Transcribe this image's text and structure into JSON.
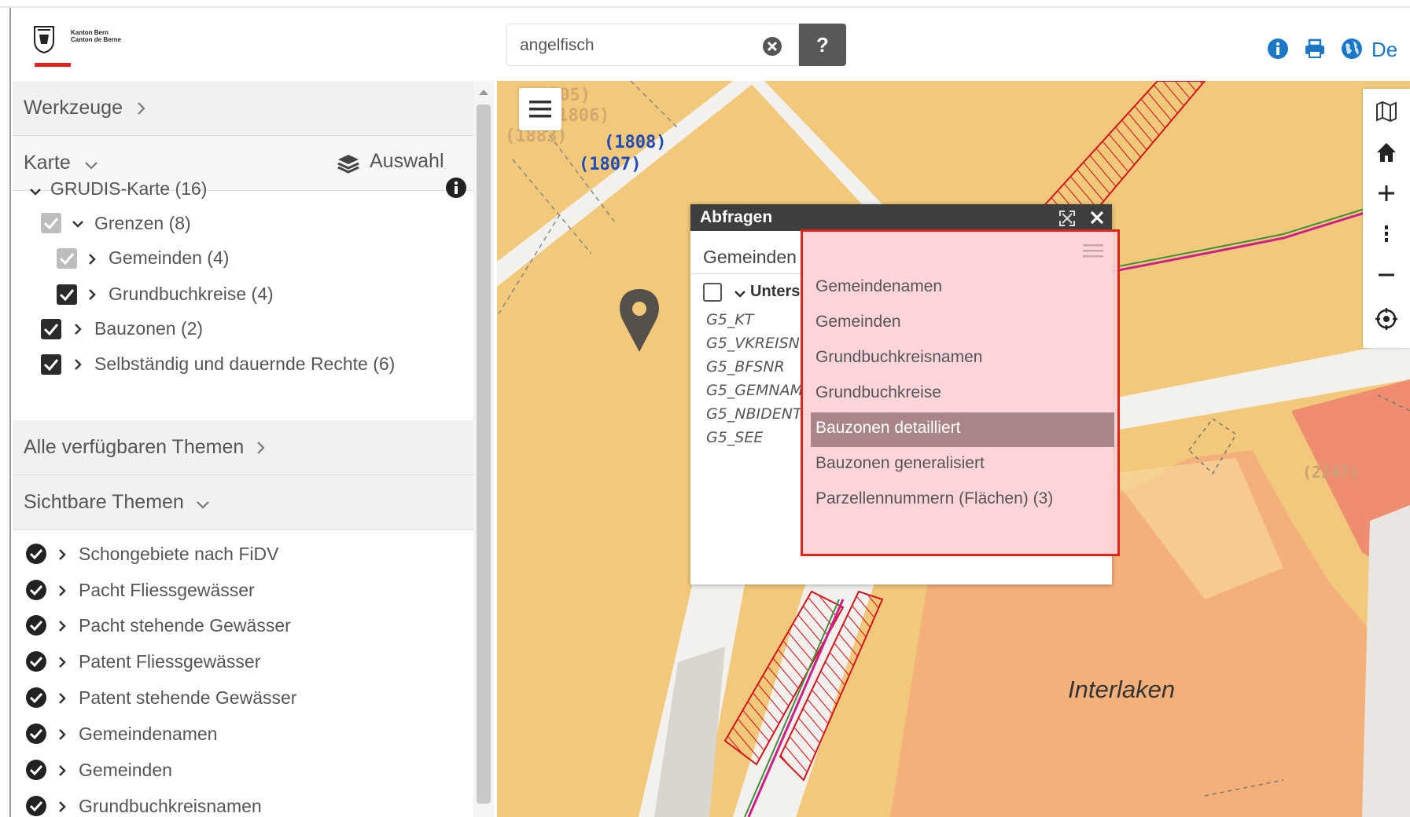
{
  "header": {
    "logo_line1": "Kanton Bern",
    "logo_line2": "Canton de Berne",
    "search_value": "angelfisch",
    "help_label": "?",
    "language": "De",
    "icons": [
      "info-icon",
      "print-icon",
      "globe-icon"
    ]
  },
  "sidebar": {
    "werkzeuge": "Werkzeuge",
    "karte": "Karte",
    "auswahl": "Auswahl",
    "tree": [
      {
        "label": "GRUDIS-Karte (16)"
      },
      {
        "label": "Grenzen (8)"
      },
      {
        "label": "Gemeinden (4)"
      },
      {
        "label": "Grundbuchkreise (4)"
      },
      {
        "label": "Bauzonen (2)"
      },
      {
        "label": "Selbständig und dauernde Rechte (6)"
      }
    ],
    "alle_themen": "Alle verfügbaren Themen",
    "sichtbare_themen": "Sichtbare Themen",
    "visible_themes": [
      "Schongebiete nach FiDV",
      "Pacht Fliessgewässer",
      "Pacht stehende Gewässer",
      "Patent Fliessgewässer",
      "Patent stehende Gewässer",
      "Gemeindenamen",
      "Gemeinden",
      "Grundbuchkreisnamen"
    ]
  },
  "map": {
    "labels": [
      "805)",
      "(1806)",
      "(1883)",
      "(1808)",
      "(1807)",
      "(2247)"
    ],
    "city": "Interlaken"
  },
  "popup": {
    "title": "Abfragen",
    "subtitle": "Gemeinden",
    "row_label": "Unters",
    "attributes": [
      "G5_KT",
      "G5_VKREISN",
      "G5_BFSNR",
      "G5_GEMNAM",
      "G5_NBIDENT",
      "G5_SEE"
    ],
    "dropdown": [
      "Gemeindenamen",
      "Gemeinden",
      "Grundbuchkreisnamen",
      "Grundbuchkreise",
      "Bauzonen detailliert",
      "Bauzonen generalisiert",
      "Parzellennummern (Flächen) (3)"
    ],
    "selected_index": 4
  },
  "colors": {
    "accent_red": "#e2231a",
    "map_yellow": "#f2c97a",
    "map_orange": "#f3b07a",
    "dark": "#3e3e3e",
    "link_blue": "#1b78c7"
  }
}
